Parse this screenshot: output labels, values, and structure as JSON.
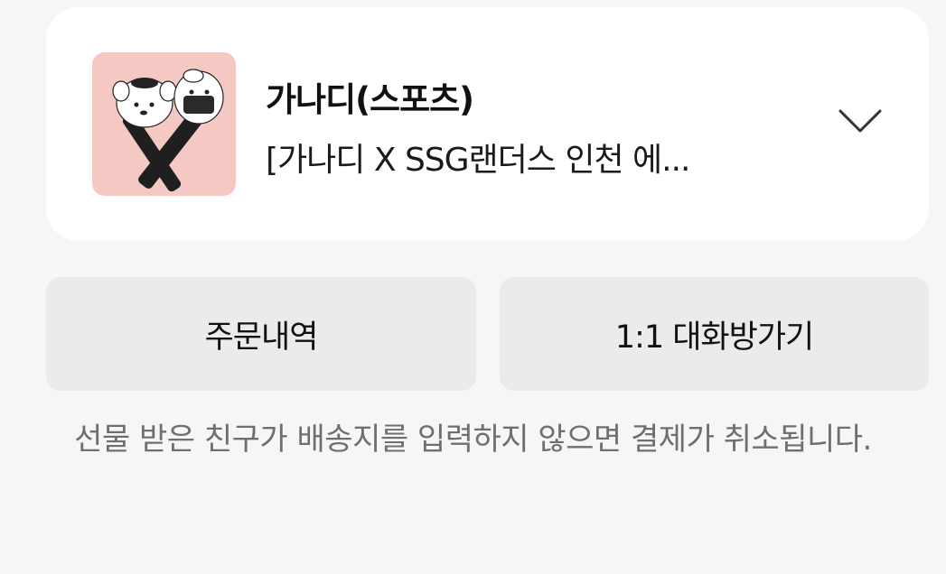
{
  "product": {
    "brand": "가나디(스포츠)",
    "title": "[가나디 X SSG랜더스 인천 에...",
    "thumbnail_icon": "product-thumbnail",
    "expand_icon": "chevron-down-icon"
  },
  "actions": {
    "orders_label": "주문내역",
    "chat_label": "1:1 대화방가기"
  },
  "notice": {
    "text": "선물 받은 친구가 배송지를 입력하지 않으면 결제가 취소됩니다."
  },
  "colors": {
    "background": "#f6f6f6",
    "card": "#ffffff",
    "button": "#ebebeb",
    "notice_text": "#6f6f6f",
    "thumbnail_bg": "#f4c9c4"
  }
}
